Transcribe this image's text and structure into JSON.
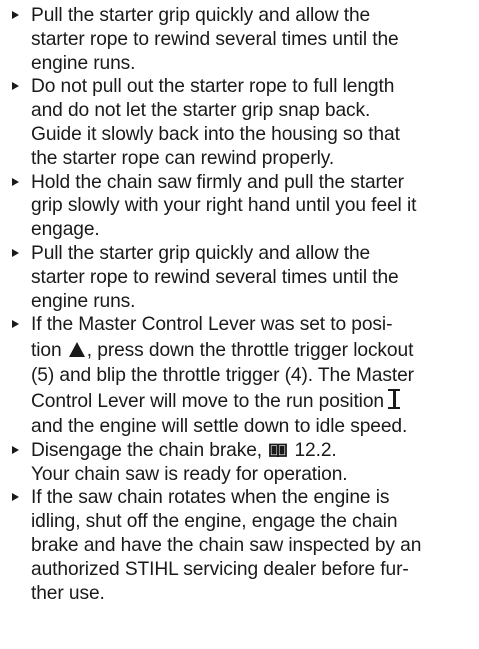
{
  "instructions": [
    {
      "lines": [
        "Pull the starter grip quickly and allow the",
        "starter rope to rewind several times until the",
        "engine runs."
      ]
    },
    {
      "lines": [
        "Do not pull out the starter rope to full length",
        "and do not let the starter grip snap back.",
        "Guide it slowly back into the housing so that",
        "the starter rope can rewind properly."
      ]
    },
    {
      "lines": [
        "Hold the chain saw firmly and pull the starter",
        "grip slowly with your right hand until you feel it",
        "engage."
      ]
    },
    {
      "lines": [
        "Pull the starter grip quickly and allow the",
        "starter rope to rewind several times until the",
        "engine runs."
      ]
    },
    {
      "line1": "If the Master Control Lever was set to posi-",
      "line2_pre": "tion",
      "line2_post": ", press down the throttle trigger lockout",
      "line3": "(5) and blip the throttle trigger (4). The Master",
      "line4_pre": "Control Lever will move to the run position",
      "line5": "and the engine will settle down to idle speed.",
      "icons": [
        "choke-position-triangle-icon",
        "run-position-symbol-icon"
      ]
    },
    {
      "line1_pre": "Disengage the chain brake,",
      "line1_ref": "12.2.",
      "line2": "Your chain saw is ready for operation.",
      "icons": [
        "book-reference-icon"
      ]
    },
    {
      "lines": [
        "If the saw chain rotates when the engine is",
        "idling, shut off the engine, engage the chain",
        "brake and have the chain saw inspected by an",
        "authorized STIHL servicing dealer before fur-",
        "ther use."
      ]
    }
  ],
  "colors": {
    "text": "#1a1a1a",
    "background": "#ffffff"
  }
}
